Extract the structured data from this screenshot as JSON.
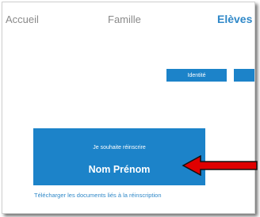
{
  "nav": {
    "accueil": "Accueil",
    "famille": "Famille",
    "eleves": "Elèves"
  },
  "tabs": {
    "identite": "Identité"
  },
  "reinscription": {
    "title": "Je souhaite réinscrire",
    "name": "Nom Prénom"
  },
  "links": {
    "download": "Télécharger les documents liés à la réinscription"
  },
  "annotation": {
    "arrow_color": "#e00000",
    "icon": "left-arrow-icon"
  },
  "colors": {
    "accent_blue": "#1c83c9",
    "nav_active": "#2f88c8",
    "nav_inactive": "#8a8a8a"
  }
}
